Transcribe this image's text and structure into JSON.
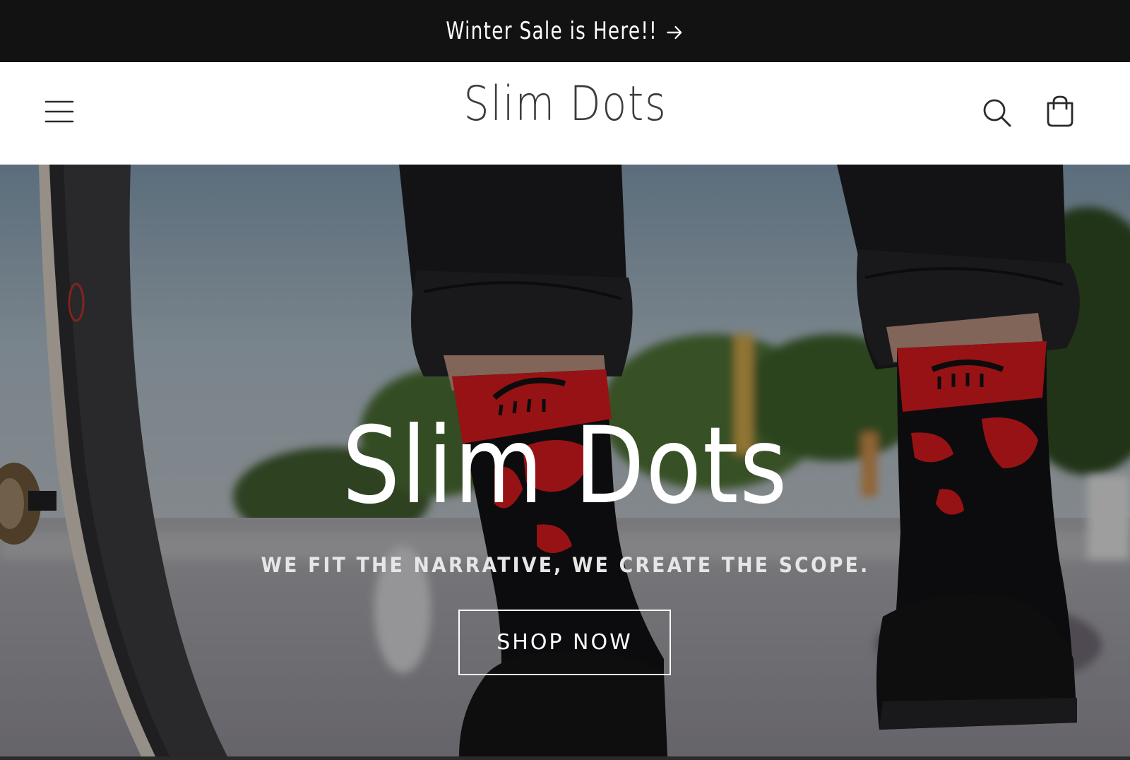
{
  "announcement": {
    "text": "Winter Sale is Here!!",
    "arrow_icon": "arrow-right-icon"
  },
  "header": {
    "brand": "Slim Dots",
    "menu_icon": "hamburger-menu-icon",
    "search_icon": "search-icon",
    "cart_icon": "cart-bag-icon"
  },
  "hero": {
    "title": "Slim Dots",
    "subtitle": "WE FIT THE NARRATIVE, WE CREATE THE SCOPE.",
    "cta_label": "SHOP NOW"
  },
  "colors": {
    "announcement_bg": "#121212",
    "brand_text": "#3d3d3d",
    "sock_red": "#d2191c",
    "pants": "#1b1b1f"
  }
}
